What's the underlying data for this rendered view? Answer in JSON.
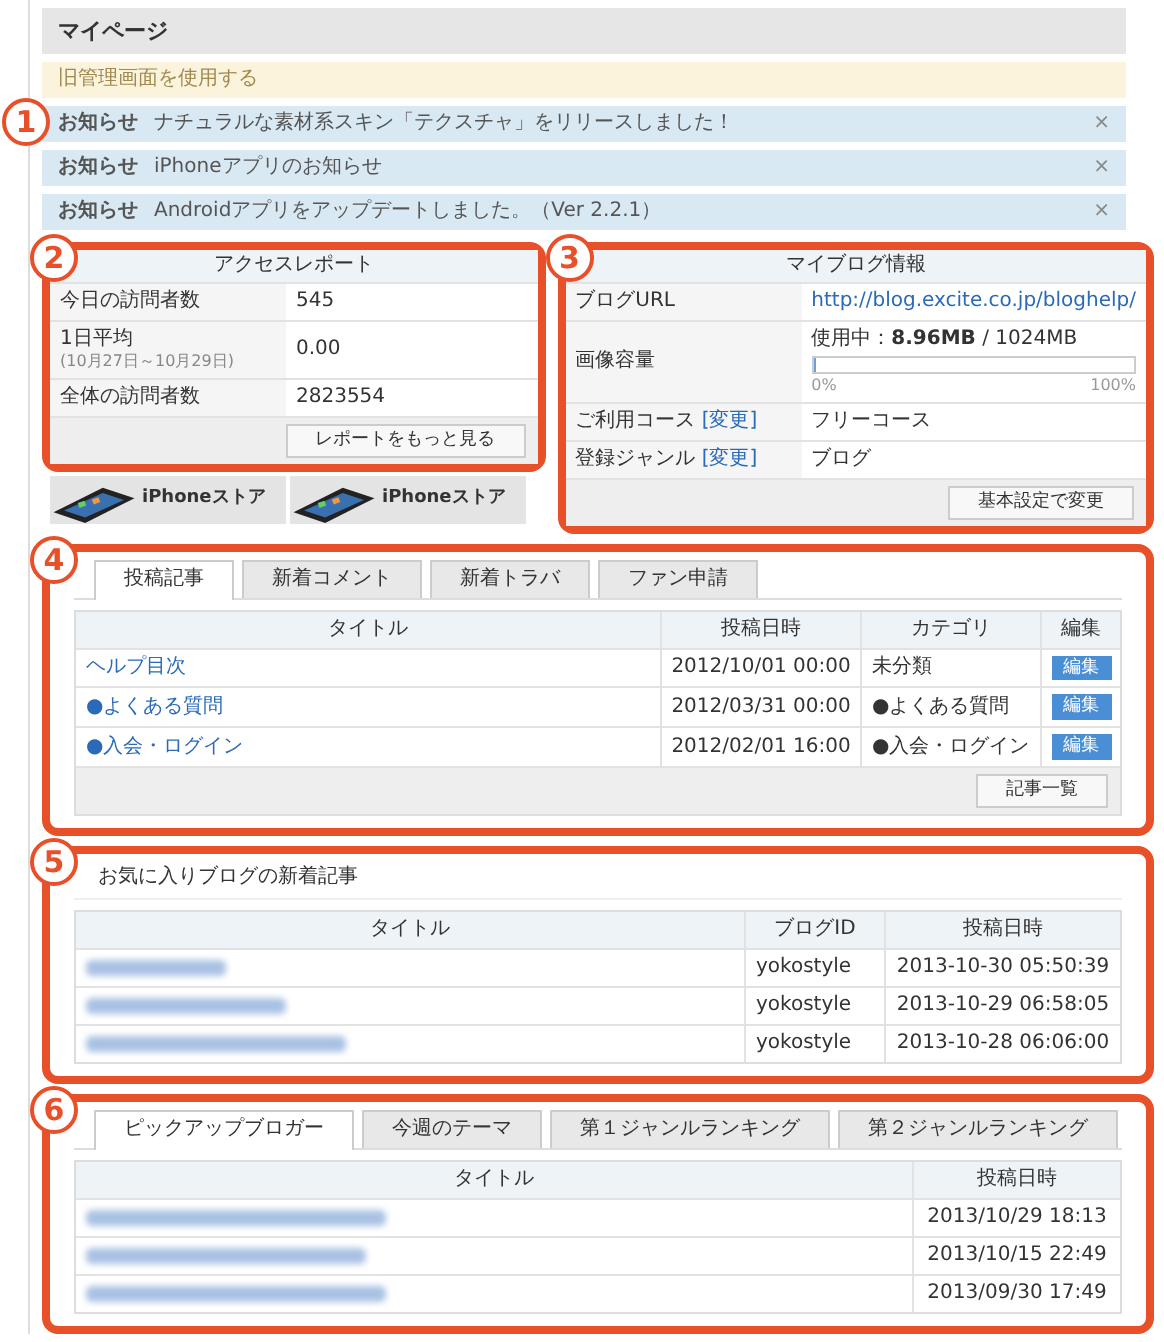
{
  "page_title": "マイページ",
  "legacy_notice": "旧管理画面を使用する",
  "notices": {
    "callout": "1",
    "items": [
      {
        "label": "お知らせ",
        "text": "ナチュラルな素材系スキン「テクスチャ」をリリースしました！",
        "close": "×"
      },
      {
        "label": "お知らせ",
        "text": "iPhoneアプリのお知らせ",
        "close": "×"
      },
      {
        "label": "お知らせ",
        "text": "Androidアプリをアップデートしました。（Ver 2.2.1）",
        "close": "×"
      }
    ]
  },
  "access_report": {
    "callout": "2",
    "title": "アクセスレポート",
    "rows": [
      {
        "label": "今日の訪問者数",
        "value": "545"
      },
      {
        "label": "1日平均",
        "note": "(10月27日～10月29日)",
        "value": "0.00"
      },
      {
        "label": "全体の訪問者数",
        "value": "2823554"
      }
    ],
    "button": "レポートをもっと見る"
  },
  "banners": [
    {
      "title": "iPhoneストア"
    },
    {
      "title": "iPhoneストア"
    }
  ],
  "blog_info": {
    "callout": "3",
    "title": "マイブログ情報",
    "url_label": "ブログURL",
    "url": "http://blog.excite.co.jp/bloghelp/",
    "storage_label": "画像容量",
    "usage": "使用中：**8.96MB** / 1024MB",
    "level": 0.01,
    "scale_min": "0%",
    "scale_max": "100%",
    "rows": [
      {
        "label": "ご利用コース",
        "link": "[変更]",
        "value": "フリーコース"
      },
      {
        "label": "登録ジャンル",
        "link": "[変更]",
        "value": "ブログ"
      }
    ],
    "button": "基本設定で変更"
  },
  "posts": {
    "callout": "4",
    "tabs": [
      {
        "label": "投稿記事",
        "selected": true
      },
      {
        "label": "新着コメント",
        "selected": false
      },
      {
        "label": "新着トラバ",
        "selected": false
      },
      {
        "label": "ファン申請",
        "selected": false
      }
    ],
    "columns": [
      "タイトル",
      "投稿日時",
      "カテゴリ",
      "編集"
    ],
    "rows": [
      {
        "title": "ヘルプ目次",
        "date": "2012/10/01 00:00",
        "category": "未分類",
        "edit": "編集"
      },
      {
        "title": "●よくある質問",
        "date": "2012/03/31 00:00",
        "category": "●よくある質問",
        "edit": "編集"
      },
      {
        "title": "●入会・ログイン",
        "date": "2012/02/01 16:00",
        "category": "●入会・ログイン",
        "edit": "編集"
      }
    ],
    "button": "記事一覧"
  },
  "favorites": {
    "callout": "5",
    "title": "お気に入りブログの新着記事",
    "columns": [
      "タイトル",
      "ブログID",
      "投稿日時"
    ],
    "rows": [
      {
        "blog_id": "yokostyle",
        "date": "2013-10-30 05:50:39"
      },
      {
        "blog_id": "yokostyle",
        "date": "2013-10-29 06:58:05"
      },
      {
        "blog_id": "yokostyle",
        "date": "2013-10-28 06:06:00"
      }
    ]
  },
  "pickup": {
    "callout": "6",
    "tabs": [
      {
        "label": "ピックアップブロガー",
        "selected": true
      },
      {
        "label": "今週のテーマ",
        "selected": false
      },
      {
        "label": "第１ジャンルランキング",
        "selected": false
      },
      {
        "label": "第２ジャンルランキング",
        "selected": false
      }
    ],
    "columns": [
      "タイトル",
      "投稿日時"
    ],
    "rows": [
      {
        "date": "2013/10/29 18:13"
      },
      {
        "date": "2013/10/15 22:49"
      },
      {
        "date": "2013/09/30 17:49"
      }
    ]
  }
}
